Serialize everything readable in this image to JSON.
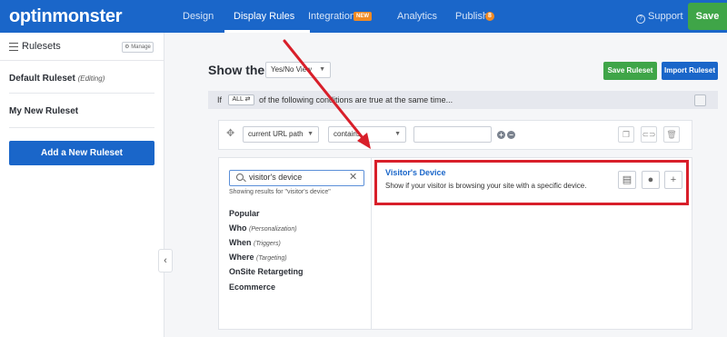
{
  "app": {
    "logo": "optinmonster",
    "save_label": "Save",
    "support_label": "Support"
  },
  "nav": {
    "design": "Design",
    "display_rules": "Display Rules",
    "integrations": "Integrations",
    "integrations_badge": "NEW",
    "analytics": "Analytics",
    "publish": "Publish",
    "publish_badge": "8"
  },
  "sidebar": {
    "title": "Rulesets",
    "manage_label": "Manage",
    "rulesets": [
      {
        "name": "Default Ruleset",
        "note": "(Editing)"
      },
      {
        "name": "My New Ruleset",
        "note": ""
      }
    ],
    "add_label": "Add a New Ruleset"
  },
  "header": {
    "show_the": "Show the",
    "view_select": "Yes/No View",
    "save_ruleset": "Save Ruleset",
    "import_ruleset": "Import Ruleset"
  },
  "conditions": {
    "if_label": "If",
    "all_label": "ALL ⇄",
    "text": "of the following conditions are true at the same time..."
  },
  "rule": {
    "field": "current URL path",
    "operator": "contains",
    "value": ""
  },
  "picker": {
    "search_value": "visitor's device",
    "showing_text": "Showing results for \"visitor's device\"",
    "categories": [
      {
        "name": "Popular",
        "note": ""
      },
      {
        "name": "Who",
        "note": "(Personalization)"
      },
      {
        "name": "When",
        "note": "(Triggers)"
      },
      {
        "name": "Where",
        "note": "(Targeting)"
      },
      {
        "name": "OnSite Retargeting",
        "note": ""
      },
      {
        "name": "Ecommerce",
        "note": ""
      }
    ],
    "result": {
      "title": "Visitor's Device",
      "description": "Show if your visitor is browsing your site with a specific device."
    }
  },
  "colors": {
    "brand_blue": "#1a66c9",
    "green": "#3fa548",
    "orange": "#f08a24",
    "highlight_red": "#d81f2a"
  }
}
